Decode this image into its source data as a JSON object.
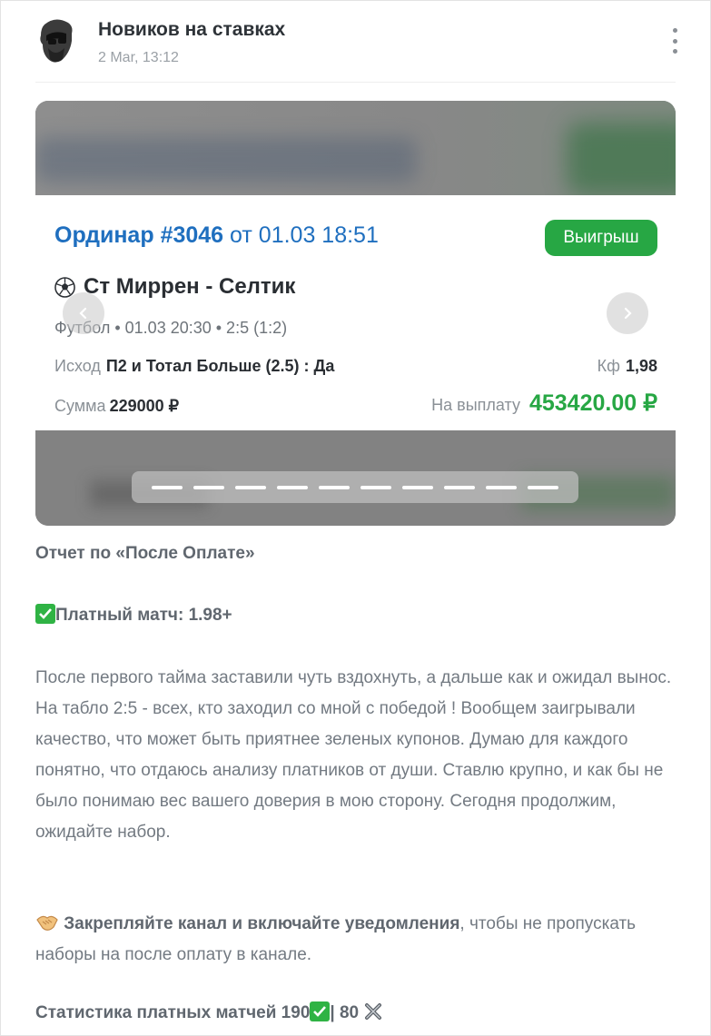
{
  "header": {
    "channel_name": "Новиков на ставках",
    "date": "2 Mar, 13:12"
  },
  "bet": {
    "type_label": "Ординар",
    "number": "#3046",
    "time": "от 01.03 18:51",
    "status": "Выигрыш",
    "match": "Ст Миррен - Селтик",
    "meta": "Футбол  •  01.03 20:30  •  2:5 (1:2)",
    "outcome_label": "Исход",
    "outcome_value": "П2 и Тотал Больше (2.5) : Да",
    "kf_label": "Кф",
    "kf_value": "1,98",
    "sum_label": "Сумма",
    "sum_value": "229000 ₽",
    "payout_label": "На выплату",
    "payout_value": "453420.00 ₽"
  },
  "carousel": {
    "slides_count": 10,
    "active_slide": 1
  },
  "post": {
    "report_title": "Отчет по «После Оплате»",
    "paid_match": "Платный матч: 1.98+",
    "paragraph": "После первого тайма заставили чуть вздохнуть, а дальше как и ожидал вынос. На табло 2:5 - всех, кто заходил со мной с победой ! Вообщем заигрывали качество, что может быть приятнее зеленых купонов. Думаю для каждого понятно, что отдаюсь анализу платников от души. Ставлю крупно, и как бы не было понимаю вес вашего доверия в мою сторону. Сегодня продолжим, ожидайте набор.",
    "cta_bold": "Закрепляйте канал и включайте уведомления",
    "cta_rest": ", чтобы не пропускать наборы на после оплату в канале.",
    "stats_prefix": "Статистика платных матчей 190",
    "stats_sep": "| 80"
  },
  "colors": {
    "accent_blue": "#1f6fbf",
    "win_green": "#27a744"
  }
}
